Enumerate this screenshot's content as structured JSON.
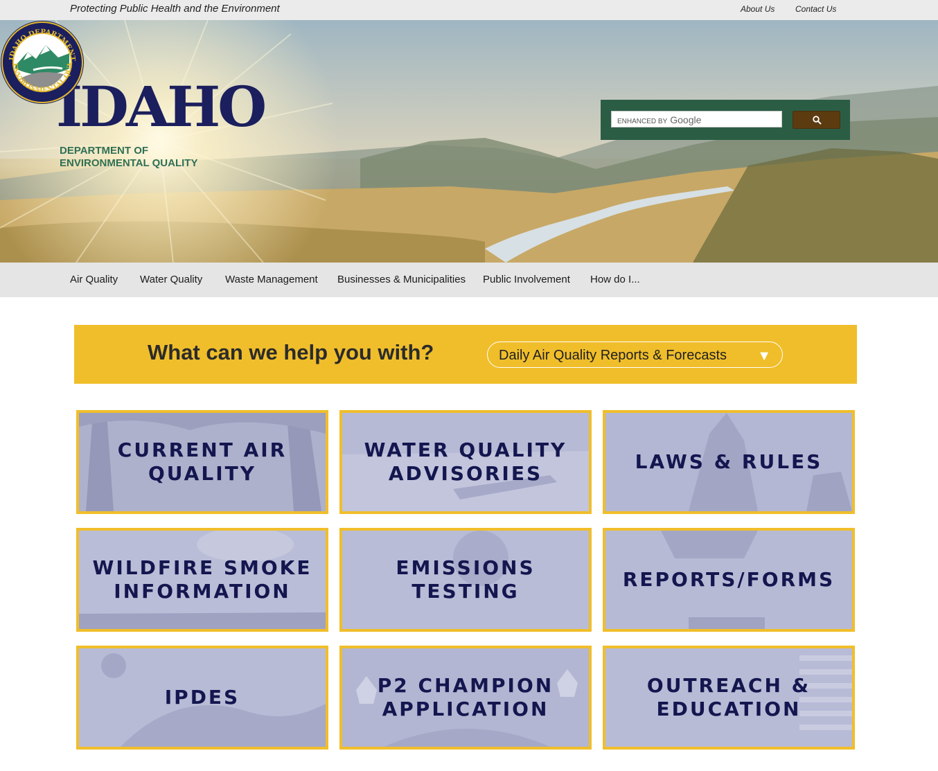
{
  "topbar": {
    "tagline": "Protecting Public Health and the Environment",
    "links": [
      "About Us",
      "Contact Us"
    ]
  },
  "header": {
    "logo_title": "IDAHO",
    "logo_subtitle_line1": "DEPARTMENT OF",
    "logo_subtitle_line2": "ENVIRONMENTAL QUALITY",
    "seal_text": "IDAHO DEPARTMENT OF ENVIRONMENTAL QUALITY"
  },
  "search": {
    "brand_prefix": "ENHANCED BY",
    "brand_name": "Google",
    "icon": "search-icon"
  },
  "nav": {
    "items": [
      "Air Quality",
      "Water Quality",
      "Waste Management",
      "Businesses & Municipalities",
      "Public Involvement",
      "How do I..."
    ]
  },
  "help": {
    "question": "What can we help you with?",
    "selected": "Daily Air Quality Reports & Forecasts",
    "arrow": "▼"
  },
  "tiles": [
    {
      "label": "CURRENT AIR QUALITY"
    },
    {
      "label": "WATER QUALITY ADVISORIES"
    },
    {
      "label": "LAWS & RULES"
    },
    {
      "label": "WILDFIRE SMOKE INFORMATION"
    },
    {
      "label": "EMISSIONS TESTING"
    },
    {
      "label": "REPORTS/FORMS"
    },
    {
      "label": "IPDES"
    },
    {
      "label": "P2 CHAMPION APPLICATION"
    },
    {
      "label": "OUTREACH & EDUCATION"
    }
  ],
  "colors": {
    "accent_gold": "#f0be2b",
    "navy": "#14164f",
    "dept_green": "#2f6f55",
    "search_green": "#2b5d45",
    "search_button": "#5c3b10"
  }
}
